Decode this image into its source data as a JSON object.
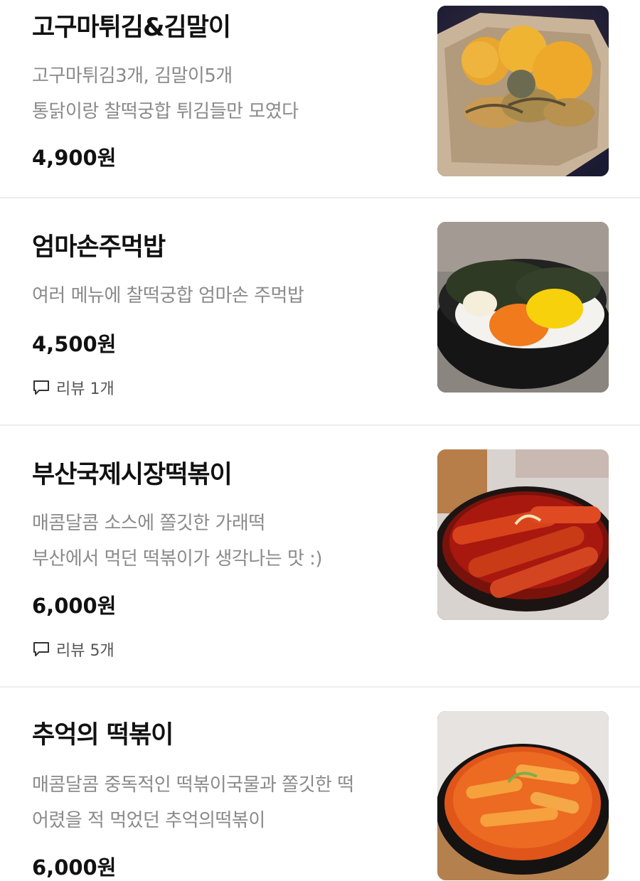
{
  "menu": {
    "items": [
      {
        "name": "고구마튀김&김말이",
        "description": [
          "고구마튀김3개, 김말이5개",
          "통닭이랑 찰떡궁합 튀김들만 모였다"
        ],
        "price": "4,900원",
        "review": "",
        "photo": "fried-sweet-potato-and-seaweed-roll-photo"
      },
      {
        "name": "엄마손주먹밥",
        "description": [
          "여러 메뉴에 찰떡궁합 엄마손 주먹밥"
        ],
        "price": "4,500원",
        "review": "리뷰 1개",
        "photo": "rice-ball-bowl-photo"
      },
      {
        "name": "부산국제시장떡볶이",
        "description": [
          "매콤달콤 소스에 쫄깃한 가래떡",
          "부산에서 먹던 떡볶이가 생각나는 맛 :)"
        ],
        "price": "6,000원",
        "review": "리뷰 5개",
        "photo": "busan-tteokbokki-photo"
      },
      {
        "name": "추억의 떡볶이",
        "description": [
          "매콤달콤 중독적인 떡볶이국물과 쫄깃한 떡",
          "어렸을 적 먹었던 추억의떡볶이"
        ],
        "price": "6,000원",
        "review": "",
        "photo": "memory-tteokbokki-photo"
      }
    ]
  },
  "icons": {
    "review": "speech-bubble-icon"
  },
  "colors": {
    "text_primary": "#111111",
    "text_secondary": "#8a8a8a",
    "review_text": "#555555",
    "divider": "#eeeeee"
  }
}
